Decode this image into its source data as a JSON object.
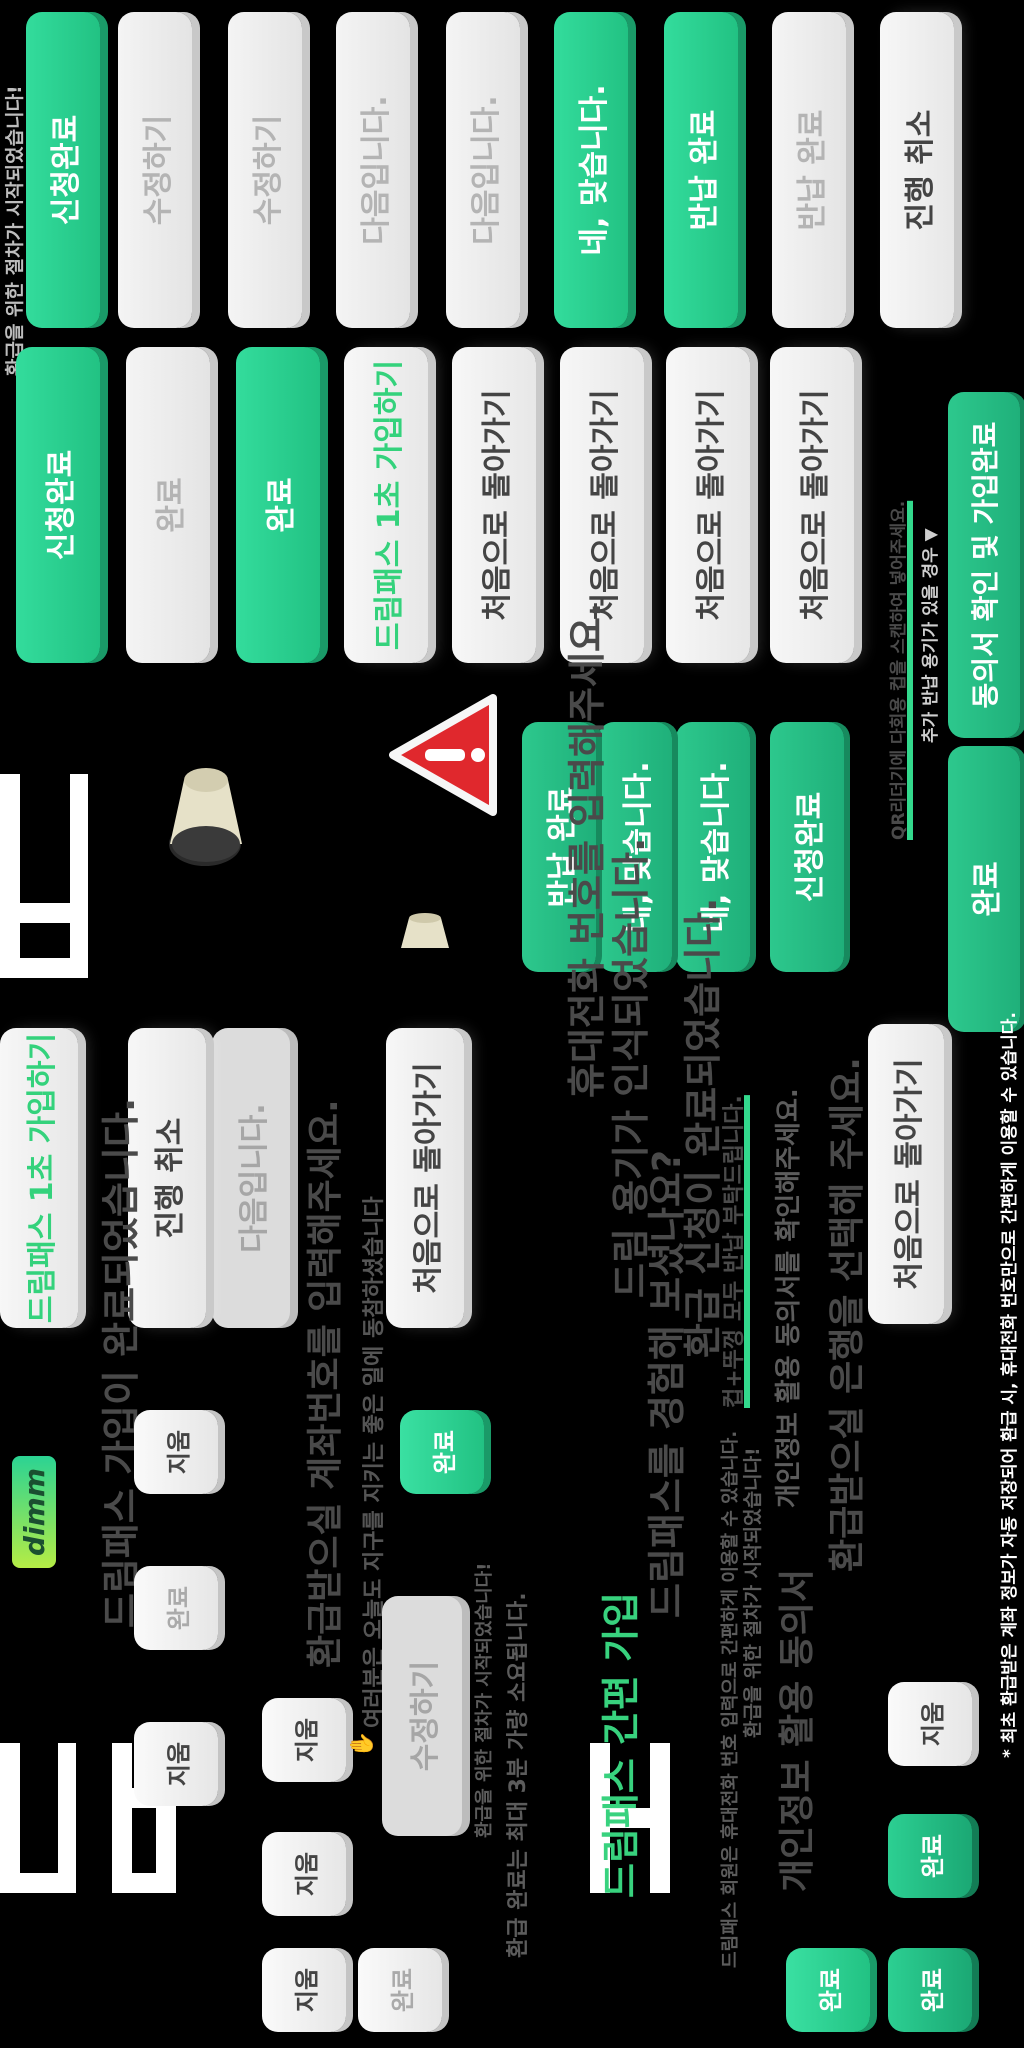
{
  "col1": {
    "header_note": "환급을 위한 절차가 시작되었습니다!",
    "btn_apply_done": "신청완료",
    "btn_edit_1": "수정하기",
    "btn_edit_2": "수정하기",
    "btn_next_1": "다음입니다.",
    "btn_next_2": "다음입니다.",
    "btn_yes": "네, 맞습니다.",
    "btn_return_done": "반납 완료",
    "btn_return_done_disabled": "반납 완료",
    "btn_cancel": "진행 취소"
  },
  "col2": {
    "btn_consent_join": "동의서 확인 및 가입완료",
    "btn_home_1": "처음으로 돌아가기",
    "btn_home_2": "처음으로 돌아가기",
    "btn_home_3": "처음으로 돌아가기",
    "btn_home_4": "처음으로 돌아가기",
    "btn_dreampass": "드림패스 1초 가입하기",
    "btn_complete_1": "완료",
    "btn_complete_2": "완료",
    "btn_apply_done_2": "신청완료",
    "extra_note": "추가 반납 용기가 있을 경우 ▼",
    "extra_note_2": "QR리더기에 다회용 컵을 스캔하여 넣어주세요."
  },
  "col3": {
    "btn_complete": "완료",
    "btn_apply_done": "신청완료",
    "btn_yes_1": "네, 맞습니다.",
    "btn_yes_2": "네, 맞습니다.",
    "btn_return_done": "반납 완료",
    "alert_icon": "warning-icon"
  },
  "col4": {
    "refund_note": "* 최초 환급받은 계좌 정보가 자동 저장되어 환급 시, 휴대전화 번호만으로 간편하게 이용할 수 있습니다.",
    "btn_home": "처음으로 돌아가기",
    "select_bank": "환급받으실 은행을 선택해 주세요.",
    "check_consent": "개인정보 활용 동의서를 확인해주세요.",
    "consent_title": "개인정보 활용 동의서",
    "refund_started": "환급을 위한 절차가 시작되었습니다!",
    "dp_note": "드림패스 회원은 휴대전화 번호 입력으로 간편하게 이용할 수 있습니다.",
    "cup_note": "컵+뚜껑 모두 반납 부탁드립니다.",
    "line_apply_done": "환급 신청이 완료되었습니다.",
    "line_try_dp": "드림패스를 경험해 보셨나요?",
    "line_dp_easy": "드림패스 간편 가입",
    "line_recognized": "드림 용기가 인식되었습니다.",
    "line_enter_phone": "휴대전화 번호를 입력해주세요.",
    "refund_time": "환급 완료는 최대 3분 가량 소요됩니다.",
    "refund_started_2": "환급을 위한 절차가 시작되었습니다!"
  },
  "col5": {
    "btn_home": "처음으로 돌아가기",
    "btn_next_disabled": "다음입니다.",
    "btn_cancel": "진행 취소",
    "btn_dreampass": "드림패스 1초 가입하기",
    "thanks": "여러분은 오늘도 지구를 지키는 좋은 일에 동참하셨습니다",
    "enter_account": "환급받으실 계좌번호를 입력해주세요.",
    "join_done": "드림패스 가입이 완료되었습니다.",
    "btn_edit_disabled": "수정하기"
  },
  "keypad": {
    "k_complete_g1": "완료",
    "k_delete_1": "지움",
    "k_complete_w1": "완료",
    "k_delete_2": "지움",
    "k_delete_3": "지움",
    "k_delete_4": "지움",
    "k_delete_5": "지움",
    "k_complete_w2": "완료",
    "k_delete_6": "지움",
    "k_complete_g2": "완료",
    "k_complete_g3": "완료",
    "k_complete_g4": "완료"
  },
  "logo_text": "dimm",
  "colors": {
    "accent": "#2bd393",
    "accent_dark": "#1fb07a",
    "text_green": "#38d27e",
    "background": "#000000"
  },
  "icons": [
    "warning-icon",
    "cup-icon",
    "small-cup-icon",
    "hand-icon"
  ]
}
